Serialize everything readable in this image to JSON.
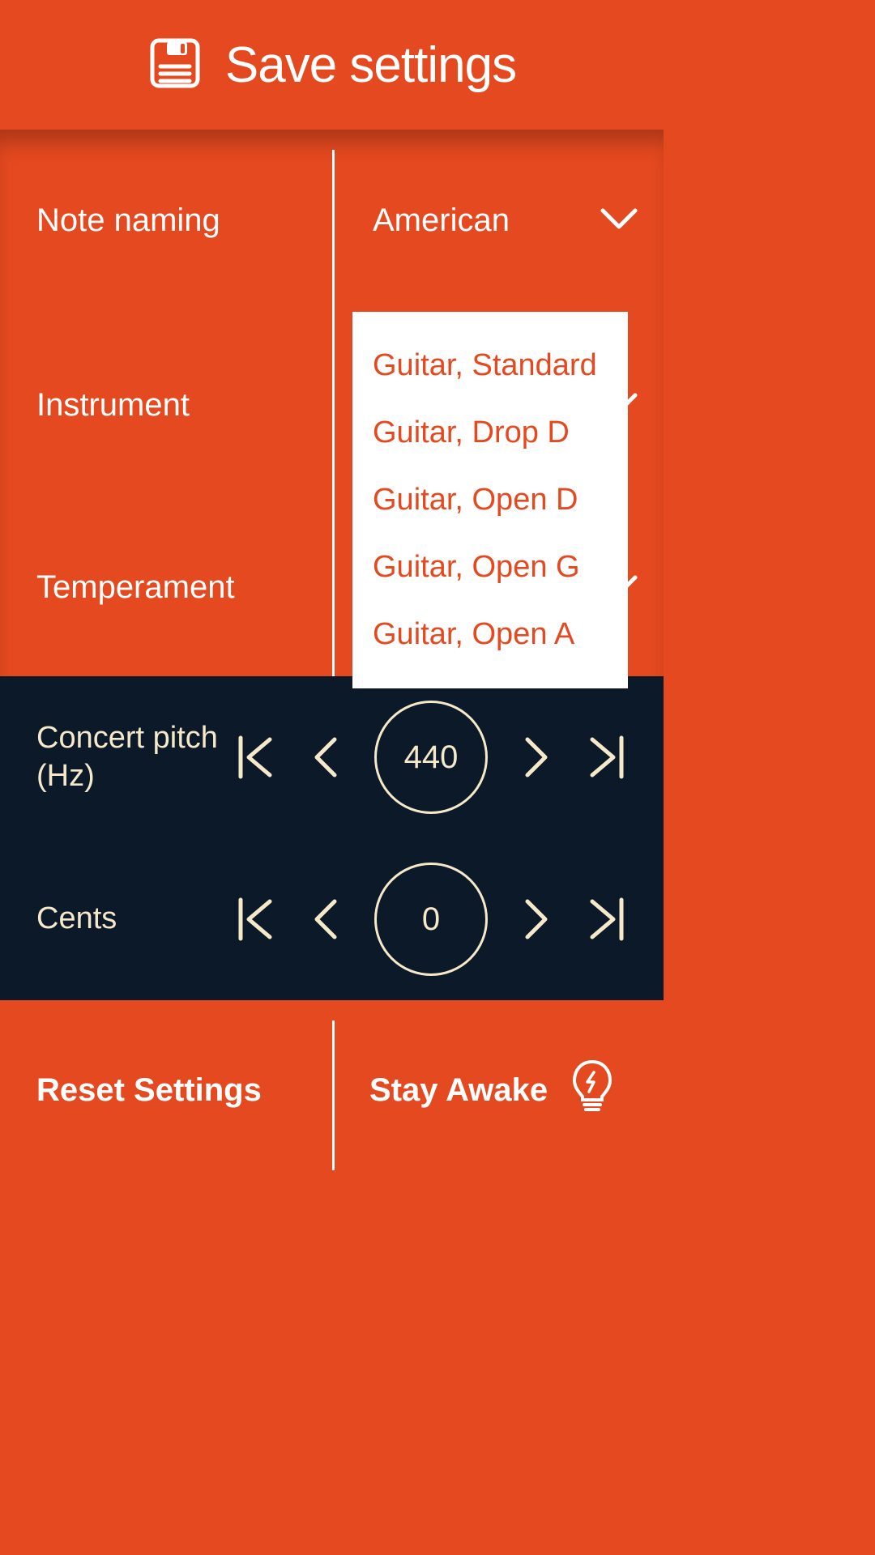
{
  "header": {
    "title": "Save settings"
  },
  "settings": {
    "note_naming": {
      "label": "Note naming",
      "value": "American"
    },
    "instrument": {
      "label": "Instrument",
      "options": [
        "Guitar, Standard",
        "Guitar, Drop D",
        "Guitar, Open D",
        "Guitar, Open G",
        "Guitar, Open A"
      ]
    },
    "temperament": {
      "label": "Temperament"
    }
  },
  "steppers": {
    "concert_pitch": {
      "label": "Concert pitch (Hz)",
      "value": "440"
    },
    "cents": {
      "label": "Cents",
      "value": "0"
    }
  },
  "footer": {
    "reset": "Reset Settings",
    "stay_awake": "Stay Awake"
  }
}
